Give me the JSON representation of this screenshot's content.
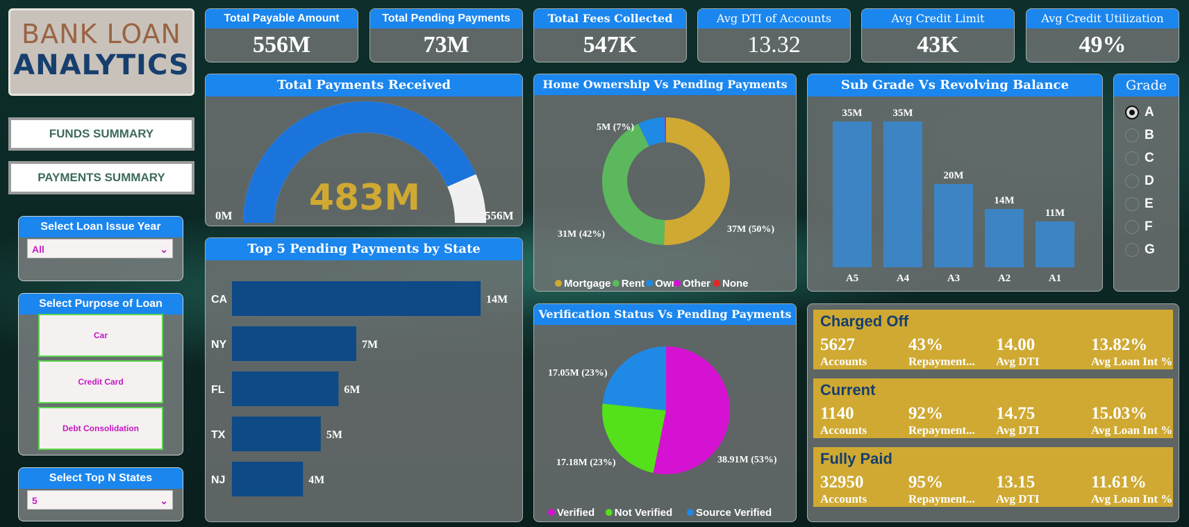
{
  "app_title": {
    "line1": "BANK LOAN",
    "line2": "ANALYTICS"
  },
  "nav": {
    "funds": "FUNDS SUMMARY",
    "payments": "PAYMENTS SUMMARY"
  },
  "slicers": {
    "year": {
      "title": "Select Loan Issue Year",
      "value": "All"
    },
    "purpose": {
      "title": "Select Purpose of Loan",
      "options": [
        "Car",
        "Credit Card",
        "Debt Consolidation"
      ]
    },
    "topn": {
      "title": "Select Top N States",
      "value": "5"
    }
  },
  "kpis": [
    {
      "label": "Total Payable Amount",
      "value": "556M"
    },
    {
      "label": "Total Pending Payments",
      "value": "73M"
    },
    {
      "label": "Total Fees Collected",
      "value": "547K"
    },
    {
      "label": "Avg DTI of Accounts",
      "value": "13.32"
    },
    {
      "label": "Avg Credit Limit",
      "value": "43K"
    },
    {
      "label": "Avg Credit Utilization",
      "value": "49%"
    }
  ],
  "gauge": {
    "title": "Total Payments Received",
    "value_label": "483M",
    "min_label": "0M",
    "max_label": "556M",
    "value": 483,
    "max": 556
  },
  "grade": {
    "title": "Grade",
    "options": [
      "A",
      "B",
      "C",
      "D",
      "E",
      "F",
      "G"
    ],
    "selected": "A"
  },
  "status_cards": [
    {
      "name": "Charged Off",
      "values": [
        "5627",
        "43%",
        "14.00",
        "13.82%"
      ],
      "labels": [
        "Accounts",
        "Repayment...",
        "Avg DTI",
        "Avg Loan Int %"
      ]
    },
    {
      "name": "Current",
      "values": [
        "1140",
        "92%",
        "14.75",
        "15.03%"
      ],
      "labels": [
        "Accounts",
        "Repayment...",
        "Avg DTI",
        "Avg Loan Int %"
      ]
    },
    {
      "name": "Fully Paid",
      "values": [
        "32950",
        "95%",
        "13.15",
        "11.61%"
      ],
      "labels": [
        "Accounts",
        "Repayment...",
        "Avg DTI",
        "Avg Loan Int %"
      ]
    }
  ],
  "colors": {
    "accent_blue": "#1a86ee",
    "gold": "#cfa932",
    "navy": "#163f6e",
    "magenta": "#d511d2",
    "green": "#54e01a"
  },
  "chart_data": [
    {
      "type": "bar",
      "orientation": "horizontal",
      "title": "Top 5 Pending Payments by State",
      "categories": [
        "CA",
        "NY",
        "FL",
        "TX",
        "NJ"
      ],
      "values": [
        14,
        7,
        6,
        5,
        4
      ],
      "labels": [
        "14M",
        "7M",
        "6M",
        "5M",
        "4M"
      ],
      "xlim": [
        0,
        14
      ],
      "color": "#0d4a86"
    },
    {
      "type": "pie",
      "donut": true,
      "title": "Home Ownership Vs Pending Payments",
      "categories": [
        "Mortgage",
        "Rent",
        "Own",
        "Other",
        "None"
      ],
      "values": [
        37,
        31,
        5,
        0.2,
        0.05
      ],
      "labels": [
        "37M (50%)",
        "31M (42%)",
        "5M (7%)",
        "",
        ""
      ],
      "colors": [
        "#d0a933",
        "#5cb85c",
        "#1e8ae6",
        "#d511d2",
        "#e32626"
      ],
      "legend": "bottom"
    },
    {
      "type": "bar",
      "title": "Sub Grade Vs Revolving Balance",
      "categories": [
        "A5",
        "A4",
        "A3",
        "A2",
        "A1"
      ],
      "values": [
        35,
        35,
        20,
        14,
        11
      ],
      "labels": [
        "35M",
        "35M",
        "20M",
        "14M",
        "11M"
      ],
      "ylim": [
        0,
        35
      ],
      "color": "#3d84c4"
    },
    {
      "type": "pie",
      "title": "Verification Status Vs Pending Payments",
      "categories": [
        "Verified",
        "Not Verified",
        "Source Verified"
      ],
      "values": [
        38.91,
        17.18,
        17.05
      ],
      "labels": [
        "38.91M (53%)",
        "17.18M (23%)",
        "17.05M (23%)"
      ],
      "colors": [
        "#d511d2",
        "#54e01a",
        "#1e8ae6"
      ],
      "legend": "bottom"
    }
  ]
}
